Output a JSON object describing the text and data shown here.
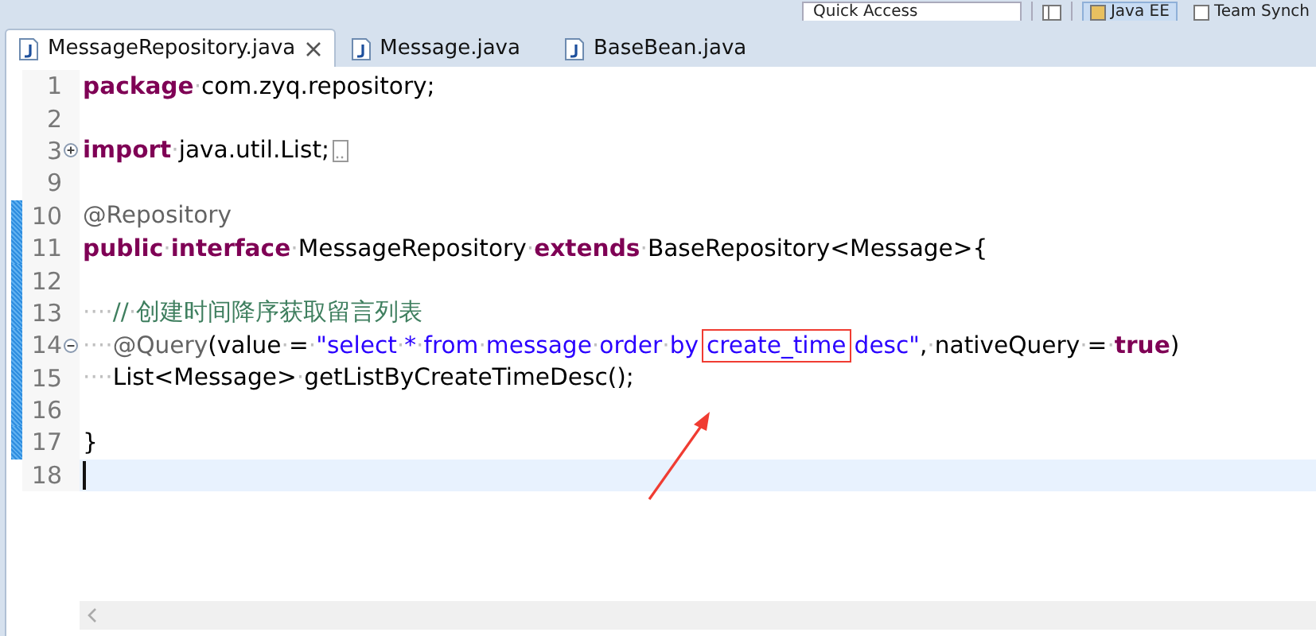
{
  "toolbar": {
    "quick_access": "Quick Access",
    "perspectives": [
      {
        "label": "Java EE",
        "selected": true
      },
      {
        "label": "Team Synch",
        "selected": false
      }
    ]
  },
  "tabs": [
    {
      "label": "MessageRepository.java",
      "selected": true
    },
    {
      "label": "Message.java",
      "selected": false
    },
    {
      "label": "BaseBean.java",
      "selected": false
    }
  ],
  "editor": {
    "lines": [
      {
        "number": "1",
        "changed": false,
        "current": false,
        "tokens": [
          {
            "kind": "kw",
            "text": "package"
          },
          {
            "kind": "ws",
            "text": "·"
          },
          {
            "kind": "plain",
            "text": "com.zyq.repository;"
          }
        ]
      },
      {
        "number": "2",
        "changed": false,
        "current": false
      },
      {
        "number": "3",
        "changed": false,
        "current": false,
        "folded": true,
        "tokens": [
          {
            "kind": "kw",
            "text": "import"
          },
          {
            "kind": "ws",
            "text": "·"
          },
          {
            "kind": "plain",
            "text": "java.util.List;"
          }
        ]
      },
      {
        "number": "9",
        "changed": false,
        "current": false
      },
      {
        "number": "10",
        "changed": true,
        "current": false,
        "tokens": [
          {
            "kind": "annot",
            "text": "@Repository"
          }
        ]
      },
      {
        "number": "11",
        "changed": true,
        "current": false,
        "tokens": [
          {
            "kind": "kw",
            "text": "public"
          },
          {
            "kind": "ws",
            "text": "·"
          },
          {
            "kind": "kw",
            "text": "interface"
          },
          {
            "kind": "ws",
            "text": "·"
          },
          {
            "kind": "plain",
            "text": "MessageRepository"
          },
          {
            "kind": "ws",
            "text": "·"
          },
          {
            "kind": "kw",
            "text": "extends"
          },
          {
            "kind": "ws",
            "text": "·"
          },
          {
            "kind": "plain",
            "text": "BaseRepository<Message>{"
          }
        ]
      },
      {
        "number": "12",
        "changed": true,
        "current": false
      },
      {
        "number": "13",
        "changed": true,
        "current": false,
        "tokens": [
          {
            "kind": "ws",
            "text": "····"
          },
          {
            "kind": "comment",
            "text": "//"
          },
          {
            "kind": "ws",
            "text": "·"
          },
          {
            "kind": "comment",
            "text": "创建时间降序获取留言列表"
          }
        ]
      },
      {
        "number": "14",
        "changed": true,
        "current": false,
        "folded": false,
        "tokens": [
          {
            "kind": "ws",
            "text": "····"
          },
          {
            "kind": "annot",
            "text": "@Query"
          },
          {
            "kind": "plain",
            "text": "(value"
          },
          {
            "kind": "ws",
            "text": "·"
          },
          {
            "kind": "plain",
            "text": "="
          },
          {
            "kind": "ws",
            "text": "·"
          },
          {
            "kind": "str",
            "text": "\"select"
          },
          {
            "kind": "ws",
            "text": "·"
          },
          {
            "kind": "str",
            "text": "*"
          },
          {
            "kind": "ws",
            "text": "·"
          },
          {
            "kind": "str",
            "text": "from"
          },
          {
            "kind": "ws",
            "text": "·"
          },
          {
            "kind": "str",
            "text": "message"
          },
          {
            "kind": "ws",
            "text": "·"
          },
          {
            "kind": "str",
            "text": "order"
          },
          {
            "kind": "ws",
            "text": "·"
          },
          {
            "kind": "str",
            "text": "by"
          },
          {
            "kind": "boxed",
            "text": "create_time"
          },
          {
            "kind": "str",
            "text": "desc\""
          },
          {
            "kind": "plain",
            "text": ","
          },
          {
            "kind": "ws",
            "text": "·"
          },
          {
            "kind": "plain",
            "text": "nativeQuery"
          },
          {
            "kind": "ws",
            "text": "·"
          },
          {
            "kind": "plain",
            "text": "="
          },
          {
            "kind": "ws",
            "text": "·"
          },
          {
            "kind": "kw",
            "text": "true"
          },
          {
            "kind": "plain",
            "text": ")"
          }
        ]
      },
      {
        "number": "15",
        "changed": true,
        "current": false,
        "tokens": [
          {
            "kind": "ws",
            "text": "····"
          },
          {
            "kind": "plain",
            "text": "List<Message>"
          },
          {
            "kind": "ws",
            "text": "·"
          },
          {
            "kind": "plain",
            "text": "getListByCreateTimeDesc();"
          }
        ]
      },
      {
        "number": "16",
        "changed": true,
        "current": false
      },
      {
        "number": "17",
        "changed": true,
        "current": false,
        "tokens": [
          {
            "kind": "plain",
            "text": "}"
          }
        ]
      },
      {
        "number": "18",
        "changed": false,
        "current": true
      }
    ]
  }
}
